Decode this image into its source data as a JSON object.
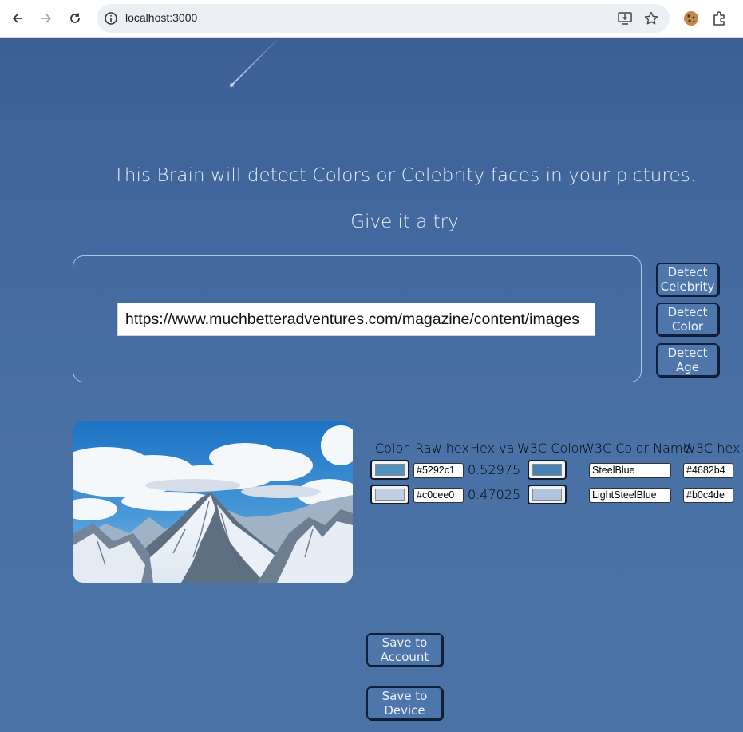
{
  "browser": {
    "url": "localhost:3000",
    "icons": [
      "back-arrow-icon",
      "forward-arrow-icon",
      "reload-icon",
      "site-info-icon",
      "install-app-icon",
      "bookmark-star-icon",
      "cookie-extension-icon",
      "extensions-puzzle-icon"
    ]
  },
  "hero": {
    "headline": "This Brain will detect Colors or Celebrity faces in your pictures.",
    "subline": "Give it a try"
  },
  "form": {
    "url_value": "https://www.muchbetteradventures.com/magazine/content/images"
  },
  "actions": {
    "detect_celebrity": [
      "Detect",
      "Celebrity"
    ],
    "detect_color": [
      "Detect",
      "Color"
    ],
    "detect_age": [
      "Detect",
      "Age"
    ]
  },
  "colors_table": {
    "headers": [
      "Color",
      "Raw hex",
      "Hex val",
      "W3C Color",
      "W3C Color Name",
      "W3C hex"
    ],
    "rows": [
      {
        "raw_hex": "#5292c1",
        "hex_val": "0.52975",
        "w3c_name": "SteelBlue",
        "w3c_hex": "#4682b4",
        "swatch": "#5292c1",
        "w3c_swatch": "#4682b4"
      },
      {
        "raw_hex": "#c0cee0",
        "hex_val": "0.47025",
        "w3c_name": "LightSteelBlue",
        "w3c_hex": "#b0c4de",
        "swatch": "#c0cee0",
        "w3c_swatch": "#b0c4de"
      }
    ]
  },
  "save": {
    "account": [
      "Save to",
      "Account"
    ],
    "device": [
      "Save to",
      "Device"
    ]
  }
}
